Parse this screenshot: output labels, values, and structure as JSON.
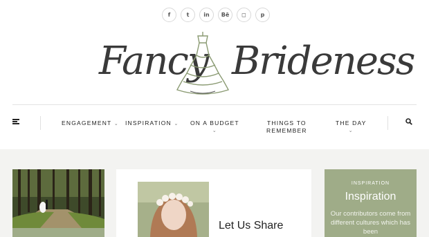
{
  "social": [
    {
      "icon": "facebook-icon",
      "glyph": "f"
    },
    {
      "icon": "twitter-icon",
      "glyph": "t"
    },
    {
      "icon": "linkedin-icon",
      "glyph": "in"
    },
    {
      "icon": "behance-icon",
      "glyph": "Bē"
    },
    {
      "icon": "instagram-icon",
      "glyph": "◻"
    },
    {
      "icon": "pinterest-icon",
      "glyph": "p"
    }
  ],
  "logo": {
    "left": "Fancy",
    "right": "Brideness"
  },
  "nav": {
    "items": [
      {
        "label": "ENGAGEMENT",
        "chevron": "⌄"
      },
      {
        "label": "INSPIRATION",
        "chevron": "⌄"
      },
      {
        "label": "ON A BUDGET",
        "chevron": "⌄"
      },
      {
        "label_line1": "THINGS TO",
        "label_line2": "REMEMBER"
      },
      {
        "label": "THE DAY",
        "chevron": "⌄"
      }
    ]
  },
  "cards": {
    "middle_title": "Let Us Share",
    "right_category": "INSPIRATION",
    "right_heading": "Inspiration",
    "right_desc": "Our contributors come from different cultures which has been"
  },
  "colors": {
    "sage": "#9fac88",
    "band": "#f3f3f1"
  }
}
